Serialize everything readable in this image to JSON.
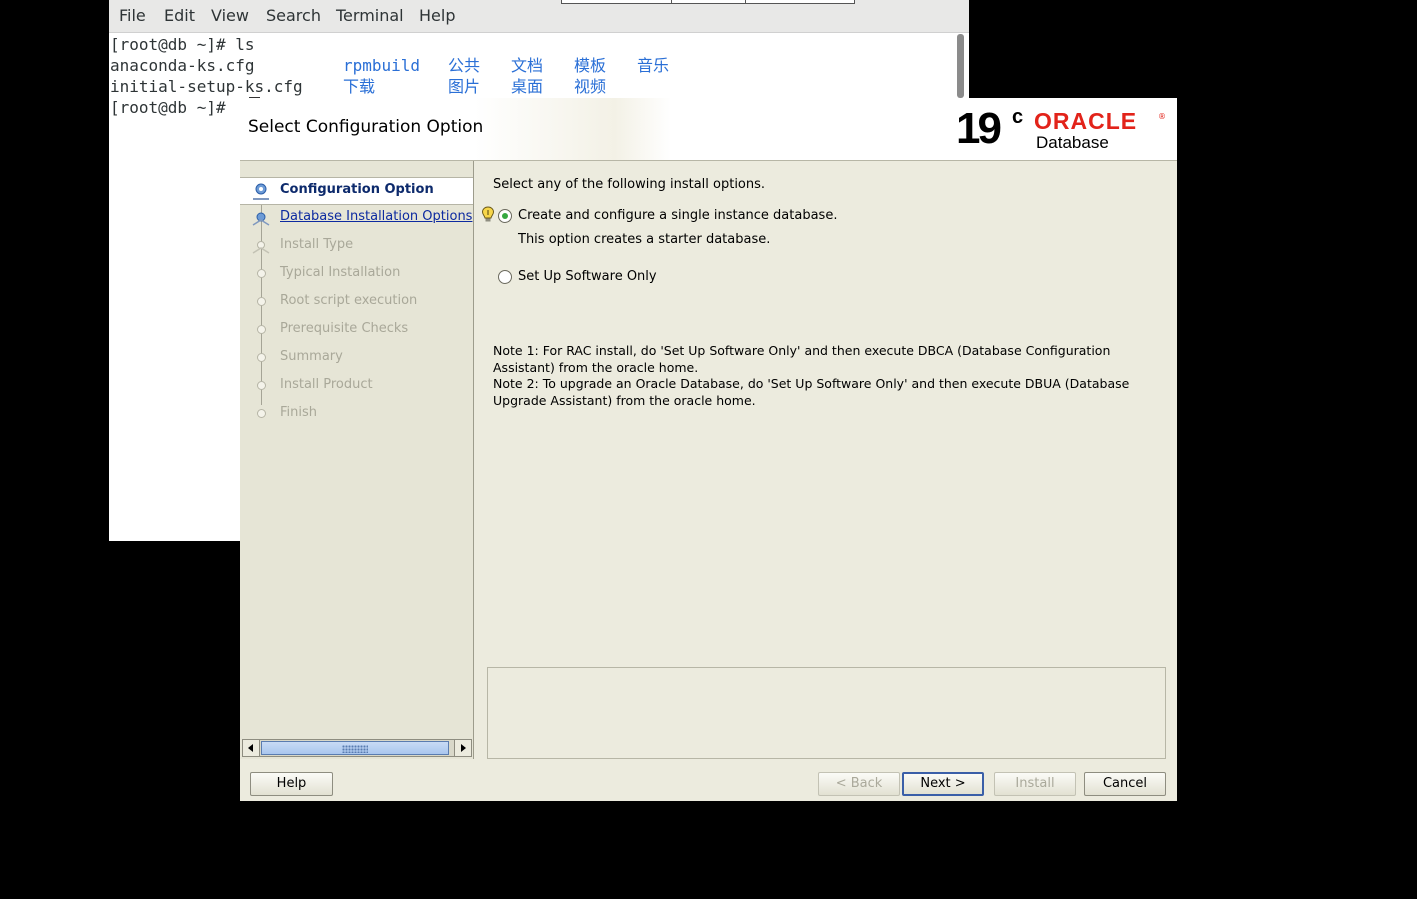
{
  "terminal": {
    "menu": [
      "File",
      "Edit",
      "View",
      "Search",
      "Terminal",
      "Help"
    ],
    "lines": {
      "l1_prompt": "[root@db ~]# ls",
      "l2_file1": "anaconda-ks.cfg",
      "l2_dir1": "rpmbuild",
      "l2_dir2": "公共",
      "l2_dir3": "文档",
      "l2_dir4": "模板",
      "l2_dir5": "音乐",
      "l3_file2": "initial-setup-ks.cfg",
      "l3_dir1": "下载",
      "l3_dir2": "图片",
      "l3_dir3": "桌面",
      "l3_dir4": "视频",
      "l4_prompt": "[root@db ~]#"
    }
  },
  "installer": {
    "title": "Select Configuration Option",
    "logo": {
      "version": "19",
      "superscript": "c",
      "brand": "ORACLE",
      "product": "Database"
    },
    "steps": [
      {
        "label": "Configuration Option",
        "state": "current"
      },
      {
        "label": "Database Installation Options",
        "state": "link"
      },
      {
        "label": "Install Type",
        "state": "disabled"
      },
      {
        "label": "Typical Installation",
        "state": "disabled"
      },
      {
        "label": "Root script execution",
        "state": "disabled"
      },
      {
        "label": "Prerequisite Checks",
        "state": "disabled"
      },
      {
        "label": "Summary",
        "state": "disabled"
      },
      {
        "label": "Install Product",
        "state": "disabled"
      },
      {
        "label": "Finish",
        "state": "disabled"
      }
    ],
    "intro": "Select any of the following install options.",
    "options": {
      "create_label": "Create and configure a single instance database.",
      "create_desc": "This option creates a starter database.",
      "software_label": "Set Up Software Only",
      "selected": "create"
    },
    "notes": {
      "note1": "Note 1: For RAC install, do 'Set Up Software Only' and then execute DBCA (Database Configuration Assistant) from the oracle home.",
      "note2": "Note 2: To upgrade an Oracle Database, do 'Set Up Software Only' and then execute DBUA (Database Upgrade Assistant) from the oracle home."
    },
    "buttons": {
      "help": "Help",
      "back": "< Back",
      "next": "Next >",
      "install": "Install",
      "cancel": "Cancel"
    }
  }
}
